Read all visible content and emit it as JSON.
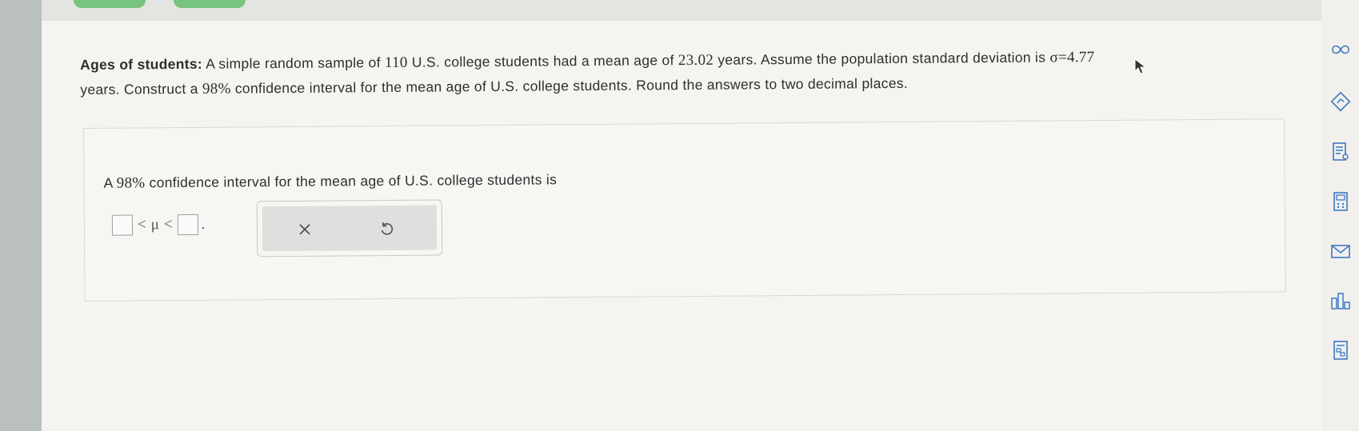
{
  "question": {
    "title": "Ages of students:",
    "line1_a": "A simple random sample of",
    "n": "110",
    "line1_b": "U.S. college students had a mean age of",
    "mean": "23.02",
    "line1_c": "years. Assume the population standard deviation is",
    "sigma": "σ=4.77",
    "line2_a": "years. Construct a",
    "conf": "98%",
    "line2_b": "confidence interval for the mean age of U.S. college students. Round the answers to two decimal places."
  },
  "answer": {
    "prompt_a": "A",
    "prompt_conf": "98%",
    "prompt_b": "confidence interval for the mean age of U.S. college students is",
    "lt1": "<",
    "mu": "μ",
    "lt2": "<",
    "period": "."
  },
  "tools": {
    "clear_icon": "close-icon",
    "undo_icon": "undo-icon"
  },
  "rail": {
    "icons": [
      "infinity-icon",
      "lightbulb-icon",
      "textbook-icon",
      "calculator-icon",
      "mail-icon",
      "stats-icon",
      "formula-sheet-icon"
    ],
    "accent": "#3e78c5"
  },
  "colors": {
    "tab_green": "#76c47d"
  }
}
